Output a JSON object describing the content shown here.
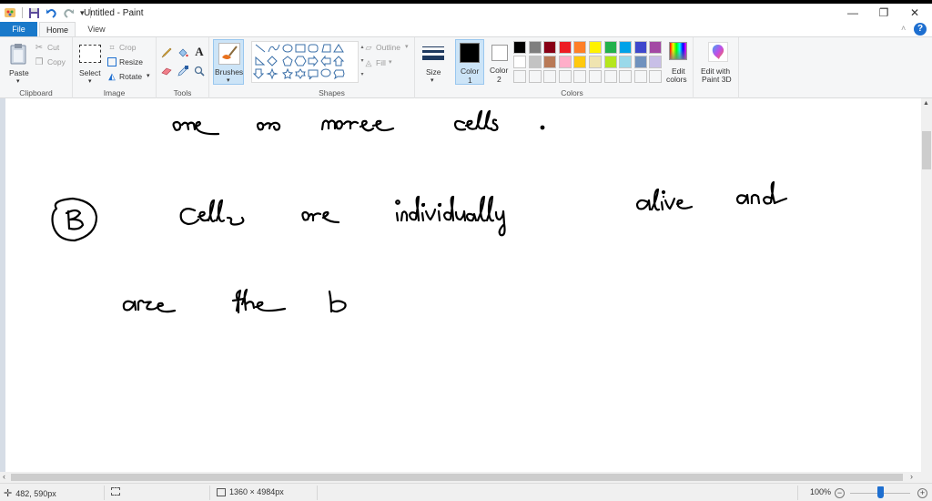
{
  "window": {
    "title": "Untitled - Paint",
    "controls": {
      "minimize": "—",
      "restore": "❐",
      "close": "✕"
    }
  },
  "quick_access": {
    "icons": [
      "paint-app-icon",
      "save-icon",
      "undo-icon",
      "redo-icon",
      "customize-qat-icon"
    ]
  },
  "tabs": [
    {
      "label": "File",
      "active": false
    },
    {
      "label": "Home",
      "active": true
    },
    {
      "label": "View",
      "active": false
    }
  ],
  "ribbon": {
    "clipboard": {
      "label": "Clipboard",
      "paste": "Paste",
      "cut": "Cut",
      "copy": "Copy"
    },
    "image": {
      "label": "Image",
      "select": "Select",
      "crop": "Crop",
      "resize": "Resize",
      "rotate": "Rotate"
    },
    "tools": {
      "label": "Tools",
      "items": [
        "pencil",
        "fill",
        "text",
        "eraser",
        "color-picker",
        "magnifier"
      ]
    },
    "brushes": {
      "label": "Brushes"
    },
    "shapes": {
      "label": "Shapes",
      "outline": "Outline",
      "fill": "Fill"
    },
    "size": {
      "label": "Size"
    },
    "colors": {
      "label": "Colors",
      "color1_label": "Color",
      "color1_num": "1",
      "color2_label": "Color",
      "color2_num": "2",
      "color1": "#000000",
      "color2": "#ffffff",
      "palette_row1": [
        "#000000",
        "#7f7f7f",
        "#880015",
        "#ed1c24",
        "#ff7f27",
        "#fff200",
        "#22b14c",
        "#00a2e8",
        "#3f48cc",
        "#a349a4"
      ],
      "palette_row2": [
        "#ffffff",
        "#c3c3c3",
        "#b97a57",
        "#ffaec9",
        "#ffc90e",
        "#efe4b0",
        "#b5e61d",
        "#99d9ea",
        "#7092be",
        "#c8bfe7"
      ],
      "edit_colors_line1": "Edit",
      "edit_colors_line2": "colors"
    },
    "paint3d": {
      "line1": "Edit with",
      "line2": "Paint 3D"
    }
  },
  "canvas": {
    "handwriting_lines": [
      "one or more cells.",
      "(B) Cells are individually alive and",
      "are the b"
    ]
  },
  "status": {
    "cursor_position": "482, 590px",
    "selection_size": "",
    "image_size": "1360 × 4984px",
    "zoom": "100%",
    "zoom_level_percent": 100
  }
}
